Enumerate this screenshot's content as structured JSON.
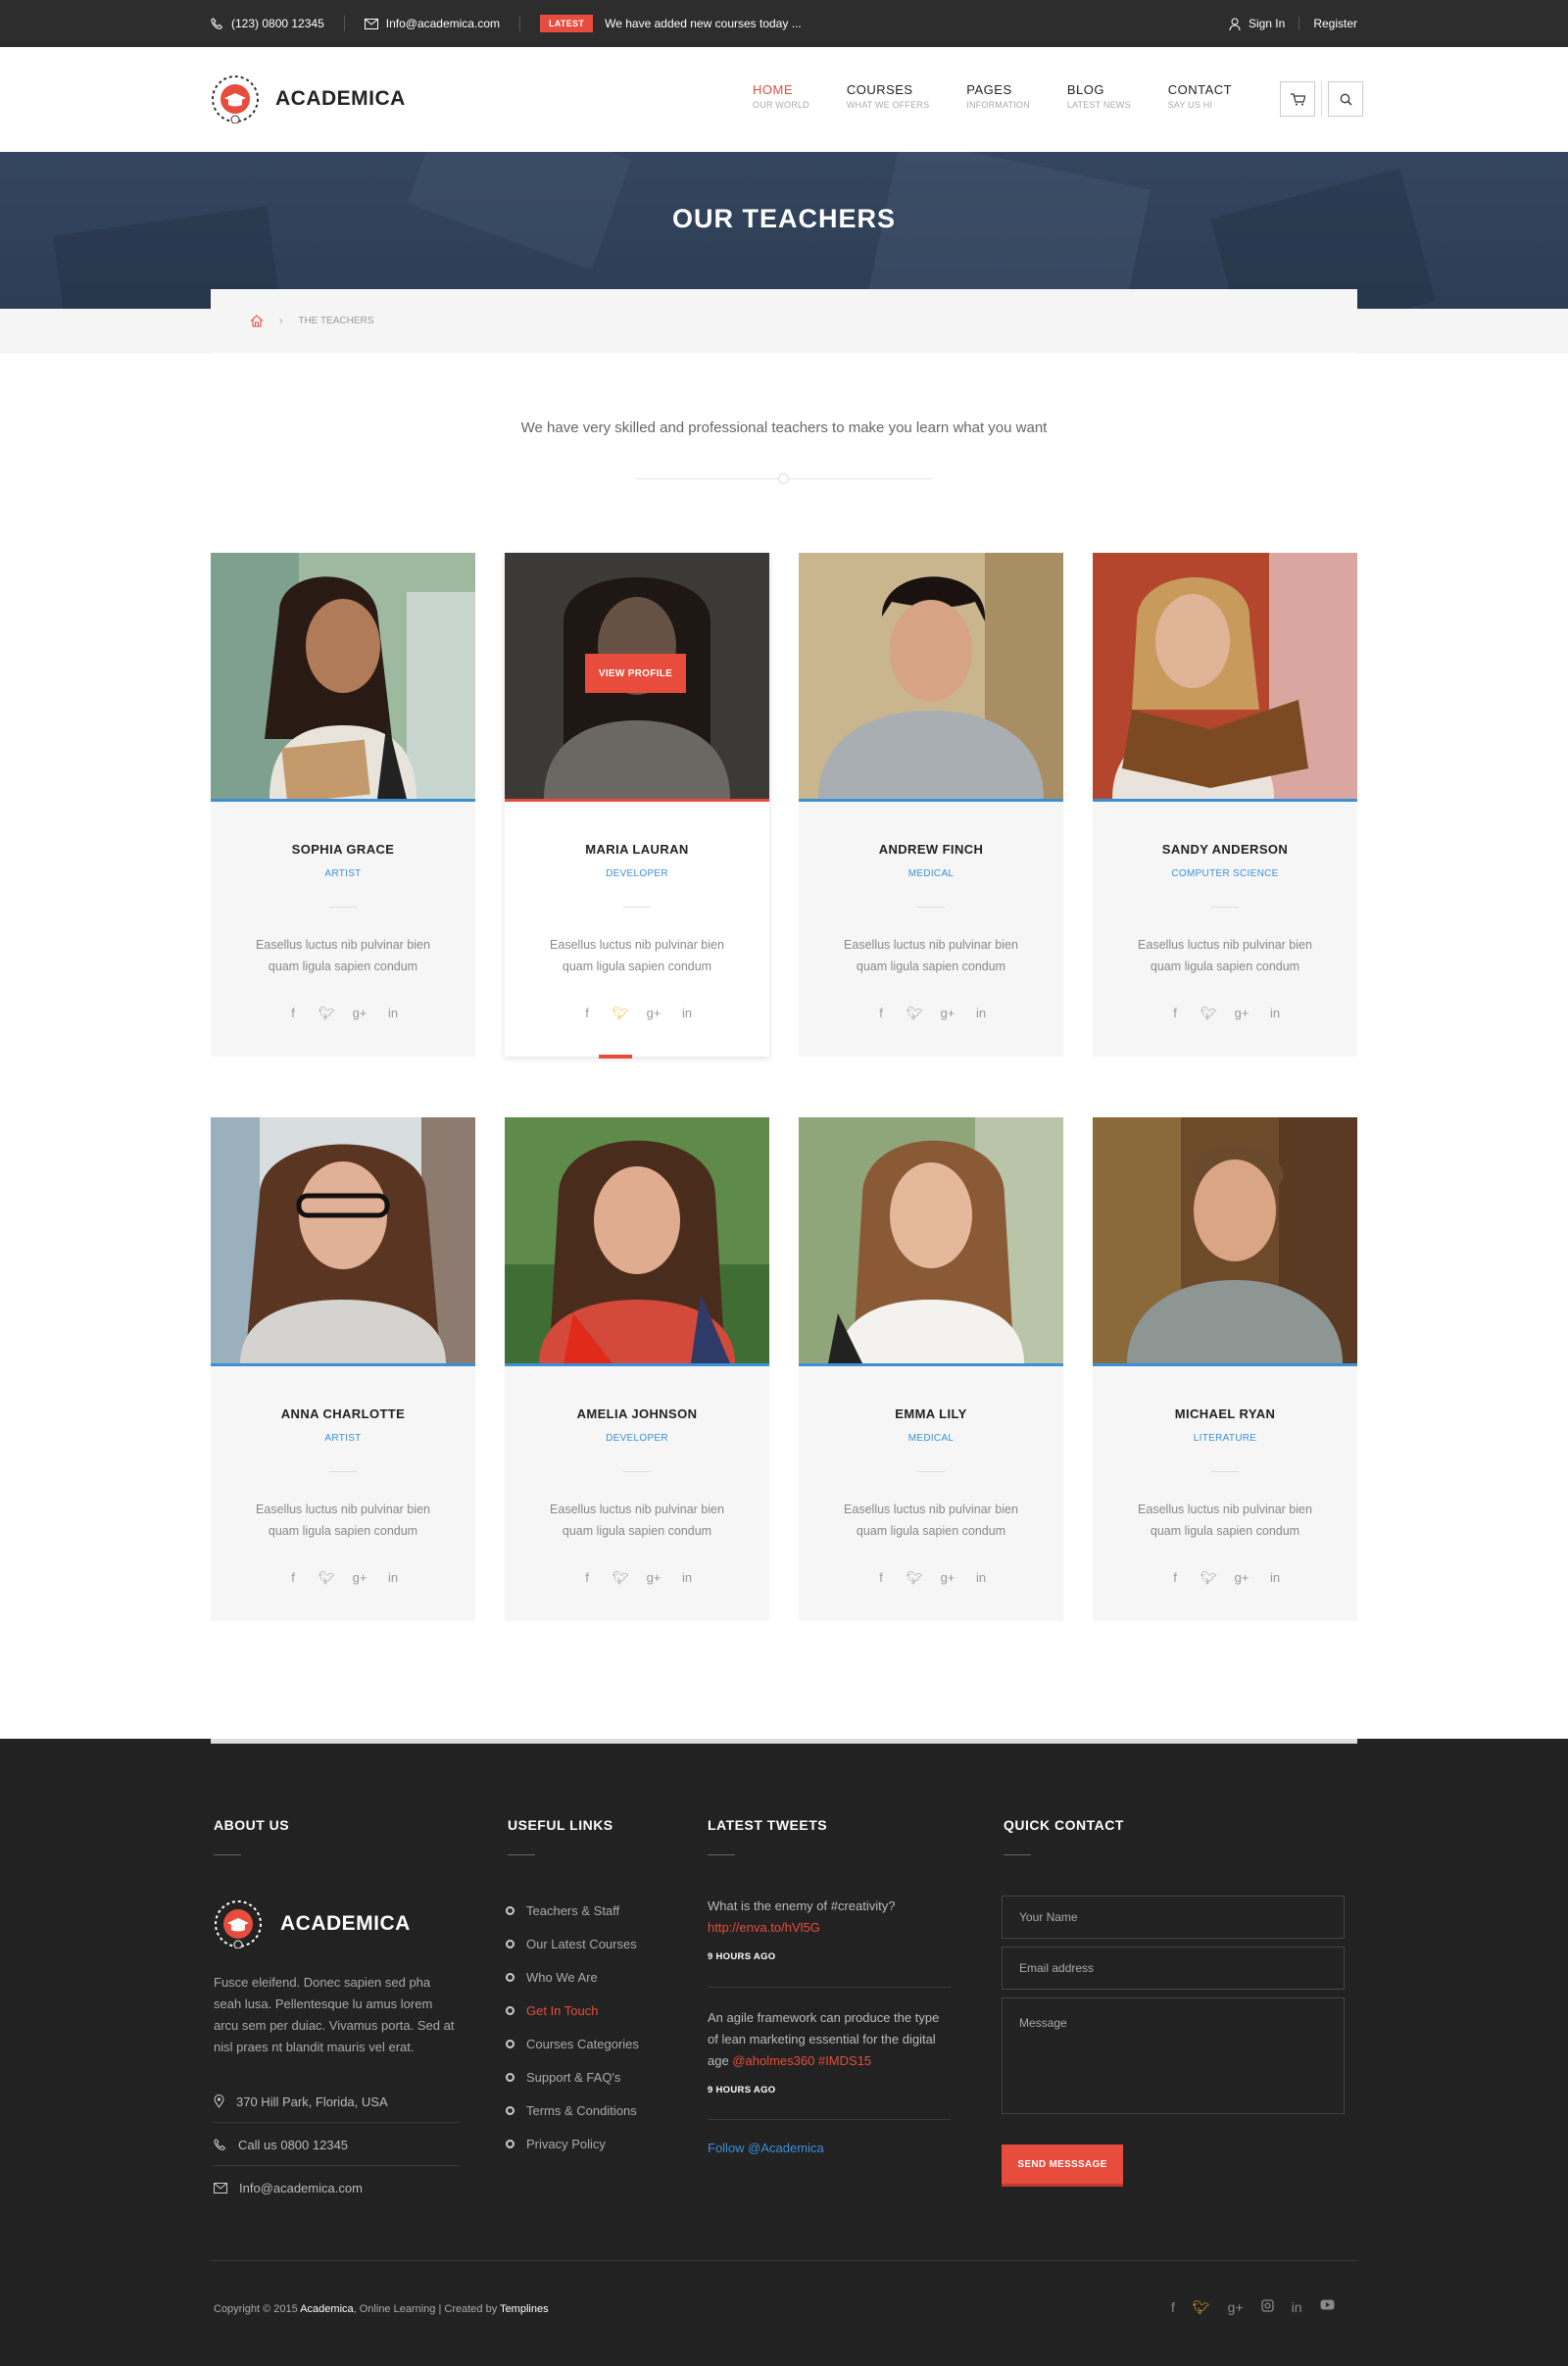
{
  "topbar": {
    "phone": "(123) 0800 12345",
    "email": "Info@academica.com",
    "latest_badge": "LATEST",
    "news": "We have added new courses today ...",
    "signin": "Sign In",
    "register": "Register"
  },
  "header": {
    "logo_text": "ACADEMICA",
    "nav": [
      {
        "label": "HOME",
        "sub": "OUR WORLD"
      },
      {
        "label": "COURSES",
        "sub": "WHAT WE OFFERS"
      },
      {
        "label": "PAGES",
        "sub": "INFORMATION"
      },
      {
        "label": "BLOG",
        "sub": "LATEST NEWS"
      },
      {
        "label": "CONTACT",
        "sub": "SAY US HI"
      }
    ]
  },
  "banner": {
    "title": "OUR TEACHERS",
    "breadcrumb": "THE TEACHERS"
  },
  "intro": "We have very skilled and professional teachers to make you learn what you want",
  "teachers": [
    {
      "name": "SOPHIA GRACE",
      "role": "ARTIST",
      "desc": "Easellus luctus nib pulvinar bien quam ligula sapien condum"
    },
    {
      "name": "MARIA LAURAN",
      "role": "DEVELOPER",
      "desc": "Easellus luctus nib pulvinar bien quam ligula sapien condum",
      "overlay_button": "VIEW PROFILE"
    },
    {
      "name": "ANDREW FINCH",
      "role": "MEDICAL",
      "desc": "Easellus luctus nib pulvinar bien quam ligula sapien condum"
    },
    {
      "name": "SANDY ANDERSON",
      "role": "COMPUTER SCIENCE",
      "desc": "Easellus luctus nib pulvinar bien quam ligula sapien condum"
    },
    {
      "name": "ANNA CHARLOTTE",
      "role": "ARTIST",
      "desc": "Easellus luctus nib pulvinar bien quam ligula sapien condum"
    },
    {
      "name": "AMELIA JOHNSON",
      "role": "DEVELOPER",
      "desc": "Easellus luctus nib pulvinar bien quam ligula sapien condum"
    },
    {
      "name": "EMMA LILY",
      "role": "MEDICAL",
      "desc": "Easellus luctus nib pulvinar bien quam ligula sapien condum"
    },
    {
      "name": "MICHAEL RYAN",
      "role": "LITERATURE",
      "desc": "Easellus luctus nib pulvinar bien quam ligula sapien condum"
    }
  ],
  "footer": {
    "about_title": "ABOUT US",
    "links_title": "USEFUL LINKS",
    "tweets_title": "LATEST TWEETS",
    "contact_title": "QUICK CONTACT",
    "logo_text": "ACADEMICA",
    "about_text": "Fusce eleifend. Donec sapien sed pha seah lusa. Pellentesque lu amus lorem arcu sem per duiac. Vivamus porta. Sed at nisl praes nt blandit mauris vel erat.",
    "address": "370 Hill Park, Florida, USA",
    "phone": "Call us 0800 12345",
    "email": "Info@academica.com",
    "links": [
      "Teachers & Staff",
      "Our Latest Courses",
      "Who We Are",
      "Get In Touch",
      "Courses Categories",
      "Support & FAQ's",
      "Terms & Conditions",
      "Privacy Policy"
    ],
    "tweet1_text": "What is the enemy of #creativity?",
    "tweet1_link": "http://enva.to/hVl5G",
    "tweet1_time": "9 HOURS AGO",
    "tweet2_text": "An agile framework can produce the type of lean marketing essential for the digital age",
    "tweet2_link": "@aholmes360 #IMDS15",
    "tweet2_time": "9 HOURS AGO",
    "follow": "Follow @Academica",
    "name_placeholder": "Your Name",
    "email_placeholder": "Email address",
    "message_placeholder": "Message",
    "send": "SEND MESSSAGE",
    "copy_prefix": "Copyright © 2015",
    "copy_brand": "Academica",
    "copy_mid": ", Online Learning | Created by",
    "copy_author": "Templines"
  },
  "colors": {
    "accent": "#e74c3c",
    "blue": "#3b8fd8",
    "dark": "#222222"
  }
}
